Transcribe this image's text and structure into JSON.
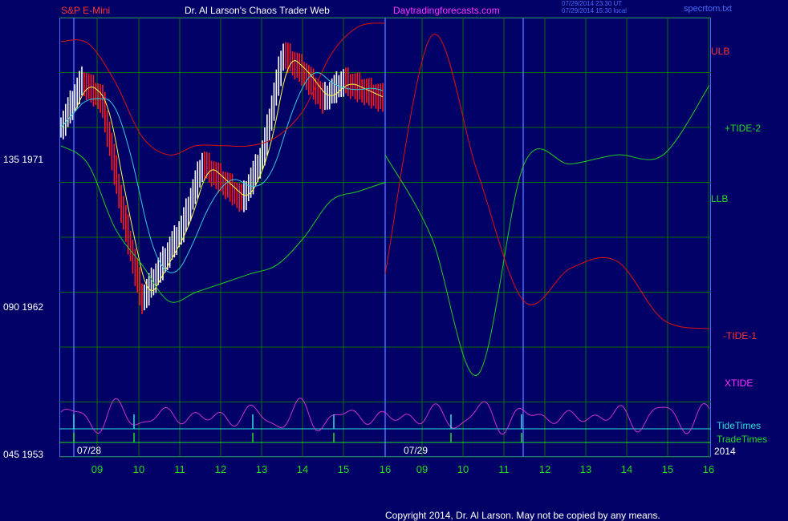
{
  "header": {
    "symbol": "S&P E-Mini",
    "author": "Dr. Al Larson's Chaos Trader Web",
    "site": "Daytradingforecasts.com",
    "stamp_ut": "07/29/2014 23:30 UT",
    "stamp_local": "07/29/2014 15:30 local",
    "spec_file": "specrtom.txt"
  },
  "y_labels": [
    {
      "text": "135  1971",
      "value": 1971
    },
    {
      "text": "090  1962",
      "value": 1962
    },
    {
      "text": "045  1953",
      "value": 1953
    }
  ],
  "right_labels": {
    "ulb": "ULB",
    "tide2": "+TIDE-2",
    "llb": "LLB",
    "tide1": "-TIDE-1",
    "xtide": "XTIDE",
    "tidetimes": "TideTimes",
    "tradetimes": "TradeTimes"
  },
  "date_labels": {
    "d1": "07/28",
    "d2": "07/29",
    "year": "2014"
  },
  "footer": {
    "copyright": "Copyright 2014, Dr. Al Larson. May not be copied by any means."
  },
  "colors": {
    "background": "#000066",
    "axis": "#4a6cff",
    "grid": "#0d6b0d",
    "ulb": "#dd1010",
    "llb": "#22cc22",
    "tide1": "#dd1010",
    "tide2": "#22cc22",
    "xtide": "#cc33cc",
    "tidetimes": "#33dddd",
    "tradetimes": "#22dd22",
    "up_bar": "#ffffff",
    "down_bar": "#ff1a1a",
    "ma_fast": "#ffff44",
    "ma_slow": "#33ccdd",
    "text_red": "#ff3333",
    "text_white": "#ffffff",
    "text_magenta": "#ff33ff",
    "text_green": "#22dd22",
    "text_cyan": "#33dddd"
  },
  "chart_data": {
    "type": "line",
    "title": "S&P E-Mini",
    "ylim": [
      1953,
      1977
    ],
    "x_ticks": [
      "09",
      "10",
      "11",
      "12",
      "13",
      "14",
      "15",
      "16",
      "09",
      "10",
      "11",
      "12",
      "13",
      "14",
      "15",
      "16"
    ],
    "session_dates": [
      "07/28",
      "07/29"
    ],
    "price_series": {
      "name": "S&P E-Mini",
      "x": [
        "07/28 08:00",
        "07/28 08:30",
        "07/28 09:00",
        "07/28 09:30",
        "07/28 10:00",
        "07/28 10:30",
        "07/28 11:00",
        "07/28 11:30",
        "07/28 12:00",
        "07/28 12:30",
        "07/28 13:00",
        "07/28 13:30",
        "07/28 14:00",
        "07/28 14:30",
        "07/28 15:00",
        "07/28 15:30",
        "07/28 16:00"
      ],
      "values": [
        1971.0,
        1973.5,
        1972.5,
        1966.5,
        1961.5,
        1963.5,
        1965.5,
        1969.0,
        1968.0,
        1967.0,
        1969.5,
        1975.0,
        1974.0,
        1972.5,
        1973.5,
        1973.0,
        1972.5
      ]
    },
    "series": [
      {
        "name": "ULB",
        "values": [
          1975.7,
          1975.6,
          1973.5,
          1970.5,
          1969.5,
          1970.0,
          1970.0,
          1970.0,
          1970.5,
          1972.0,
          1975.0,
          1976.5,
          1976.7
        ]
      },
      {
        "name": "LLB",
        "values": [
          1970.0,
          1969.0,
          1965.5,
          1963.5,
          1961.5,
          1962.0,
          1962.5,
          1963.0,
          1963.5,
          1965.0,
          1967.0,
          1967.5,
          1968.0
        ]
      },
      {
        "name": "+TIDE-2",
        "values": [
          1969.5,
          1965.0,
          1957.5,
          1969.0,
          1969.0,
          1969.5,
          1969.5,
          1973.3
        ]
      },
      {
        "name": "-TIDE-1",
        "values": [
          1963.0,
          1976.0,
          1968.5,
          1961.5,
          1963.3,
          1963.7,
          1960.5,
          1960.0
        ]
      }
    ]
  }
}
